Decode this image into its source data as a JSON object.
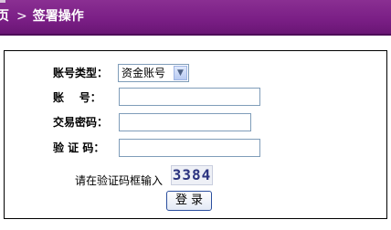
{
  "breadcrumb": {
    "first": "页",
    "separator": ">",
    "current": "签署操作"
  },
  "form": {
    "account_type_label": "账号类型：",
    "account_type_value": "资金账号",
    "account_label": "账    号：",
    "account_value": "",
    "password_label": "交易密码：",
    "password_value": "",
    "captcha_label": "验 证 码：",
    "captcha_value": "",
    "captcha_hint": "请在验证码框输入",
    "captcha_code": "3384",
    "login_button": "登录"
  },
  "colors": {
    "titlebar": "#7b1f86",
    "panel_border": "#000000",
    "input_border": "#7f9db9"
  },
  "icons": {
    "dropdown": "chevron-down-icon"
  }
}
